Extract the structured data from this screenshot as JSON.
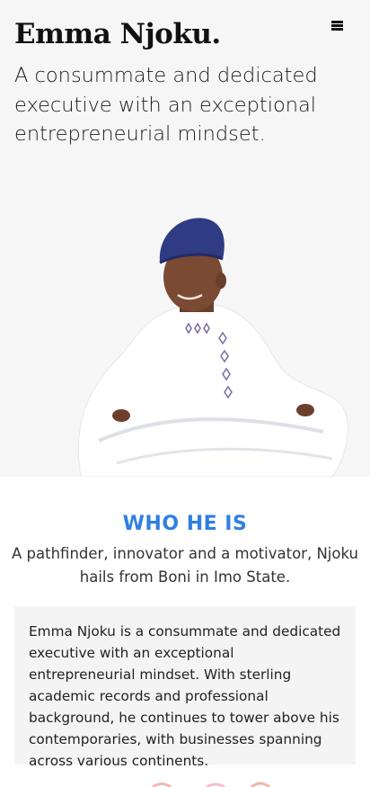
{
  "header": {
    "site_title": "Emma Njoku.",
    "menu_icon": "hamburger-menu-icon"
  },
  "hero": {
    "tagline": "A consummate and dedicated executive with an exceptional entrepreneurial mindset.",
    "background_color": "#f7f6f7"
  },
  "about": {
    "title": "WHO HE IS",
    "intro": "A pathfinder, innovator and a motivator, Njoku hails from Boni in Imo State.",
    "bio": "Emma Njoku is a consummate and dedicated executive with an exceptional entrepreneurial mindset. With sterling academic records and professional background, he continues to tower above his contemporaries, with businesses spanning across various continents.",
    "title_color": "#2f80e0",
    "card_color": "#f4f4f4"
  }
}
